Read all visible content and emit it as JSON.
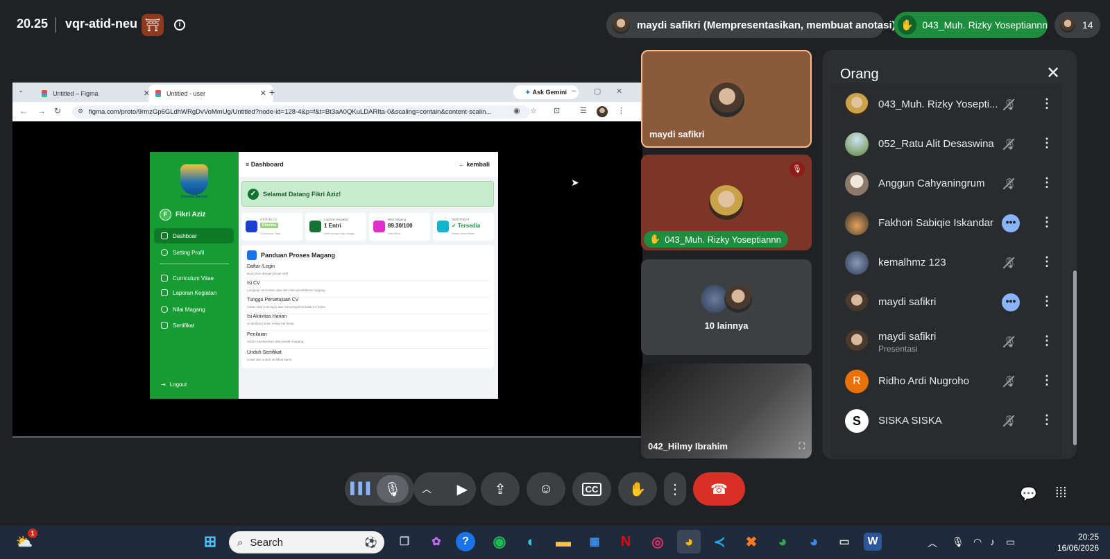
{
  "meeting": {
    "time": "20.25",
    "code": "vqr-atid-neu",
    "presenter_label": "maydi safikri (Mempresentasikan, membuat anotasi)",
    "raised_hand_label": "043_Muh. Rizky Yoseptiannn",
    "participant_count": "14"
  },
  "browser": {
    "tabs": [
      {
        "label": "Untitled – Figma"
      },
      {
        "label": "Untitled - user"
      }
    ],
    "ask_gemini": "Ask Gemini",
    "url": "figma.com/proto/9rmzGp6GLdhWRgDvVoMmUg/Untitled?node-id=128-4&p=f&t=Bt3aA0QKuLDARIta-0&scaling=contain&content-scalin..."
  },
  "app": {
    "brand_caption": "Provinsi Banten",
    "user_initial": "F",
    "user_name": "Fikri Aziz",
    "menu": [
      "Dashboar",
      "Setting Profil",
      "Curriculum Vitae",
      "Laporan Kegiatan",
      "Nilai Magang",
      "Sertifikat"
    ],
    "logout": "Logout",
    "page_title": "Dashboard",
    "back_label": "← kembali",
    "welcome": "Selamat Datang Fikri Aziz!",
    "stats": [
      {
        "label": "STATUS CV",
        "value": "Diterima",
        "sub": "Curriculum Vitae"
      },
      {
        "label": "Laporan Kegiatan",
        "value": "1 Entri",
        "sub": "Aktif mengisi tiap minggu"
      },
      {
        "label": "Nilai Magang",
        "value": "89.30/100",
        "sub": "Nilai Akhir"
      },
      {
        "label": "SERTIFIKAT",
        "value": "✓ Tersedia",
        "sub": "Admin terverifikasi"
      }
    ],
    "guide_title": "Panduan Proses Magang",
    "steps": [
      {
        "title": "Daftar /Login",
        "desc": "Buat Akun dengan Email Aktif"
      },
      {
        "title": "Isi CV",
        "desc": "Lengkapi curriculum vitae dan data pendaftaran magang"
      },
      {
        "title": "Tunggu Persetujuan CV",
        "desc": "Admin akan meninjau dan menyetujui/menolak CV kamu"
      },
      {
        "title": "Isi Aktivitas Harian",
        "desc": "Isi aktifitas harian setiap hari kerja"
      },
      {
        "title": "Penilaian",
        "desc": "Admin memberikan nilai setelah magang"
      },
      {
        "title": "Unduh Sertifikat",
        "desc": "Cetak dan unduh sertifikat kamu"
      }
    ]
  },
  "tiles": {
    "t1_name": "maydi safikri",
    "t2_name": "043_Muh. Rizky Yoseptiannn",
    "t3_label": "10 lainnya",
    "t4_name": "042_Hilmy Ibrahim"
  },
  "people_panel": {
    "title": "Orang",
    "rows": [
      {
        "name": "043_Muh. Rizky Yosepti...",
        "status": "muted"
      },
      {
        "name": "052_Ratu Alit Desaswina",
        "status": "muted"
      },
      {
        "name": "Anggun Cahyaningrum",
        "status": "muted"
      },
      {
        "name": "Fakhori Sabiqie Iskandar",
        "status": "talking"
      },
      {
        "name": "kemalhmz 123",
        "status": "muted"
      },
      {
        "name": "maydi safikri",
        "status": "talking"
      },
      {
        "name": "maydi safikri",
        "sub": "Presentasi",
        "status": "muted"
      },
      {
        "name": "Ridho Ardi Nugroho",
        "initial": "R",
        "status": "muted"
      },
      {
        "name": "SISKA SISKA",
        "initial": "S",
        "status": "muted"
      }
    ]
  },
  "taskbar": {
    "search_placeholder": "Search",
    "notification_badge": "1",
    "clock_time": "20:25",
    "clock_date": "16/06/2026"
  },
  "colors": {
    "meet_bg": "#202124",
    "accent_green": "#1e8e3e",
    "leave_red": "#d93025",
    "app_green": "#169c32"
  }
}
